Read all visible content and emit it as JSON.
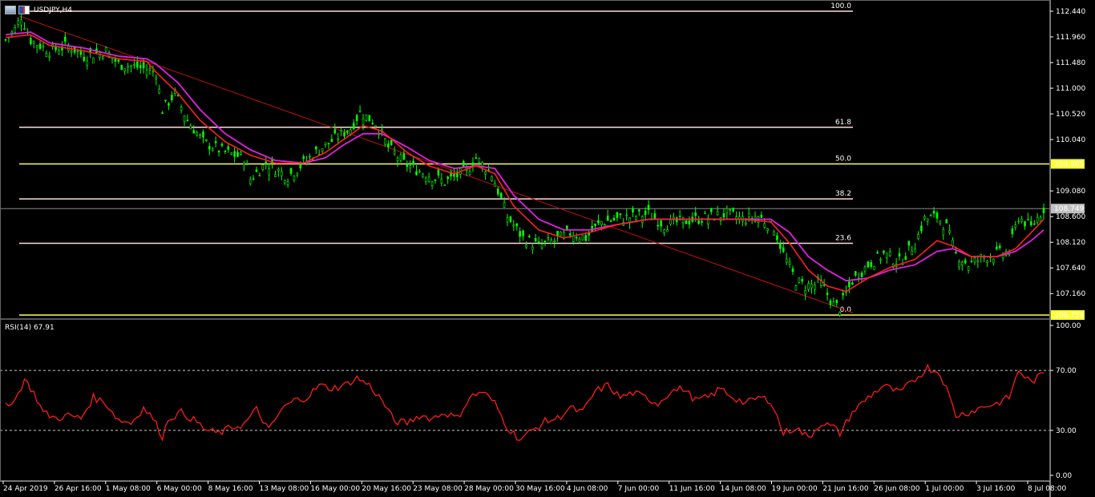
{
  "window": {
    "symbol_label": "USDJPY,H4",
    "rsi_label": "RSI(14) 67.91"
  },
  "colors": {
    "bg": "#000000",
    "candle": "#00ff00",
    "ma_fast": "#ff2020",
    "ma_slow": "#e020e0",
    "fib_line": "#ffdcdc",
    "fib_key": "#ffff66",
    "trend": "#c01010",
    "rsi": "#ff1a1a",
    "axis": "#ffffff"
  },
  "chart_data": [
    {
      "type": "candlestick",
      "title": "USDJPY,H4",
      "ylim": [
        106.759,
        112.44
      ],
      "y_ticks": [
        "112.440",
        "111.960",
        "111.480",
        "111.000",
        "110.520",
        "110.040",
        "109.080",
        "108.600",
        "108.120",
        "107.640",
        "107.160"
      ],
      "x_ticks": [
        "24 Apr 2019",
        "26 Apr 16:00",
        "1 May 08:00",
        "6 May 00:00",
        "8 May 16:00",
        "13 May 08:00",
        "16 May 00:00",
        "20 May 16:00",
        "23 May 08:00",
        "28 May 00:00",
        "30 May 16:00",
        "4 Jun 08:00",
        "7 Jun 00:00",
        "11 Jun 16:00",
        "14 Jun 08:00",
        "19 Jun 00:00",
        "21 Jun 16:00",
        "26 Jun 08:00",
        "1 Jul 00:00",
        "3 Jul 16:00",
        "8 Jul 08:00"
      ],
      "price_labels": {
        "current": "108.749",
        "fib_50": "109.585",
        "fib_0": "106.759"
      },
      "fibonacci": [
        {
          "level": "100.0",
          "price": 112.44
        },
        {
          "level": "61.8",
          "price": 110.27
        },
        {
          "level": "50.0",
          "price": 109.585
        },
        {
          "level": "38.2",
          "price": 108.93
        },
        {
          "level": "23.6",
          "price": 108.1
        },
        {
          "level": "0.0",
          "price": 106.759
        }
      ],
      "trendline": {
        "from": 112.35,
        "to": 106.8
      },
      "close_path": [
        [
          0,
          111.9
        ],
        [
          3,
          112.1
        ],
        [
          5,
          112.35
        ],
        [
          8,
          111.9
        ],
        [
          14,
          111.7
        ],
        [
          20,
          111.8
        ],
        [
          25,
          111.6
        ],
        [
          32,
          111.7
        ],
        [
          36,
          111.45
        ],
        [
          42,
          111.4
        ],
        [
          48,
          111.3
        ],
        [
          50,
          110.6
        ],
        [
          54,
          110.9
        ],
        [
          58,
          110.4
        ],
        [
          63,
          110.0
        ],
        [
          70,
          109.8
        ],
        [
          76,
          109.7
        ],
        [
          78,
          109.3
        ],
        [
          83,
          109.6
        ],
        [
          90,
          109.35
        ],
        [
          95,
          109.6
        ],
        [
          100,
          109.85
        ],
        [
          106,
          110.1
        ],
        [
          110,
          110.25
        ],
        [
          113,
          110.55
        ],
        [
          118,
          110.35
        ],
        [
          122,
          109.9
        ],
        [
          127,
          109.6
        ],
        [
          132,
          109.45
        ],
        [
          140,
          109.25
        ],
        [
          147,
          109.45
        ],
        [
          150,
          109.7
        ],
        [
          155,
          109.4
        ],
        [
          160,
          108.6
        ],
        [
          165,
          108.2
        ],
        [
          170,
          108.05
        ],
        [
          175,
          108.15
        ],
        [
          180,
          108.3
        ],
        [
          185,
          108.2
        ],
        [
          190,
          108.5
        ],
        [
          195,
          108.55
        ],
        [
          200,
          108.6
        ],
        [
          205,
          108.65
        ],
        [
          210,
          108.45
        ],
        [
          215,
          108.5
        ],
        [
          220,
          108.55
        ],
        [
          225,
          108.6
        ],
        [
          230,
          108.65
        ],
        [
          235,
          108.55
        ],
        [
          240,
          108.6
        ],
        [
          245,
          108.4
        ],
        [
          248,
          107.9
        ],
        [
          252,
          107.4
        ],
        [
          255,
          107.3
        ],
        [
          260,
          107.35
        ],
        [
          264,
          106.95
        ],
        [
          266,
          106.9
        ],
        [
          270,
          107.4
        ],
        [
          275,
          107.7
        ],
        [
          280,
          107.9
        ],
        [
          285,
          107.75
        ],
        [
          290,
          108.1
        ],
        [
          293,
          108.55
        ],
        [
          297,
          108.6
        ],
        [
          300,
          108.4
        ],
        [
          303,
          107.9
        ],
        [
          307,
          107.7
        ],
        [
          312,
          107.85
        ],
        [
          316,
          107.9
        ],
        [
          320,
          107.95
        ],
        [
          323,
          108.6
        ],
        [
          327,
          108.4
        ],
        [
          331,
          108.75
        ]
      ],
      "ma_fast_path": [
        [
          0,
          111.95
        ],
        [
          8,
          112.0
        ],
        [
          14,
          111.8
        ],
        [
          25,
          111.7
        ],
        [
          36,
          111.55
        ],
        [
          45,
          111.5
        ],
        [
          48,
          111.3
        ],
        [
          55,
          110.9
        ],
        [
          62,
          110.4
        ],
        [
          70,
          110.0
        ],
        [
          78,
          109.75
        ],
        [
          86,
          109.6
        ],
        [
          95,
          109.6
        ],
        [
          102,
          109.8
        ],
        [
          108,
          110.05
        ],
        [
          114,
          110.3
        ],
        [
          120,
          110.2
        ],
        [
          128,
          109.8
        ],
        [
          135,
          109.55
        ],
        [
          143,
          109.4
        ],
        [
          150,
          109.55
        ],
        [
          156,
          109.4
        ],
        [
          162,
          108.8
        ],
        [
          170,
          108.35
        ],
        [
          178,
          108.2
        ],
        [
          186,
          108.3
        ],
        [
          195,
          108.45
        ],
        [
          205,
          108.55
        ],
        [
          215,
          108.55
        ],
        [
          225,
          108.55
        ],
        [
          235,
          108.55
        ],
        [
          244,
          108.5
        ],
        [
          250,
          108.1
        ],
        [
          256,
          107.6
        ],
        [
          262,
          107.3
        ],
        [
          268,
          107.2
        ],
        [
          275,
          107.45
        ],
        [
          282,
          107.65
        ],
        [
          290,
          107.8
        ],
        [
          297,
          108.15
        ],
        [
          302,
          108.05
        ],
        [
          308,
          107.85
        ],
        [
          316,
          107.85
        ],
        [
          322,
          108.0
        ],
        [
          327,
          108.3
        ],
        [
          331,
          108.55
        ]
      ],
      "ma_slow_path": [
        [
          0,
          112.0
        ],
        [
          8,
          112.05
        ],
        [
          14,
          111.85
        ],
        [
          25,
          111.75
        ],
        [
          36,
          111.6
        ],
        [
          45,
          111.55
        ],
        [
          48,
          111.45
        ],
        [
          55,
          111.1
        ],
        [
          62,
          110.6
        ],
        [
          70,
          110.15
        ],
        [
          78,
          109.85
        ],
        [
          86,
          109.65
        ],
        [
          95,
          109.6
        ],
        [
          102,
          109.7
        ],
        [
          108,
          109.95
        ],
        [
          114,
          110.15
        ],
        [
          120,
          110.15
        ],
        [
          128,
          109.9
        ],
        [
          135,
          109.65
        ],
        [
          143,
          109.5
        ],
        [
          150,
          109.55
        ],
        [
          156,
          109.5
        ],
        [
          162,
          109.0
        ],
        [
          170,
          108.55
        ],
        [
          178,
          108.35
        ],
        [
          186,
          108.35
        ],
        [
          195,
          108.45
        ],
        [
          205,
          108.55
        ],
        [
          215,
          108.55
        ],
        [
          225,
          108.55
        ],
        [
          235,
          108.55
        ],
        [
          244,
          108.55
        ],
        [
          250,
          108.3
        ],
        [
          256,
          107.85
        ],
        [
          262,
          107.6
        ],
        [
          268,
          107.4
        ],
        [
          275,
          107.45
        ],
        [
          282,
          107.6
        ],
        [
          290,
          107.7
        ],
        [
          297,
          107.95
        ],
        [
          302,
          108.0
        ],
        [
          308,
          107.85
        ],
        [
          316,
          107.85
        ],
        [
          322,
          107.95
        ],
        [
          327,
          108.15
        ],
        [
          331,
          108.35
        ]
      ]
    },
    {
      "type": "line",
      "title": "RSI(14) 67.91",
      "ylim": [
        0,
        100
      ],
      "y_ticks": [
        "100.00",
        "70.00",
        "30.00",
        "0.00"
      ],
      "levels": [
        70,
        30
      ],
      "rsi_path": [
        [
          0,
          48
        ],
        [
          3,
          50
        ],
        [
          6,
          64
        ],
        [
          9,
          55
        ],
        [
          12,
          42
        ],
        [
          16,
          38
        ],
        [
          20,
          40
        ],
        [
          24,
          38
        ],
        [
          28,
          52
        ],
        [
          32,
          48
        ],
        [
          36,
          37
        ],
        [
          40,
          35
        ],
        [
          44,
          45
        ],
        [
          47,
          38
        ],
        [
          50,
          26
        ],
        [
          52,
          38
        ],
        [
          56,
          42
        ],
        [
          60,
          37
        ],
        [
          64,
          30
        ],
        [
          68,
          28
        ],
        [
          72,
          32
        ],
        [
          76,
          34
        ],
        [
          80,
          44
        ],
        [
          84,
          30
        ],
        [
          88,
          44
        ],
        [
          92,
          50
        ],
        [
          96,
          52
        ],
        [
          100,
          60
        ],
        [
          104,
          58
        ],
        [
          108,
          60
        ],
        [
          112,
          65
        ],
        [
          116,
          60
        ],
        [
          120,
          50
        ],
        [
          124,
          36
        ],
        [
          128,
          35
        ],
        [
          132,
          40
        ],
        [
          136,
          38
        ],
        [
          140,
          42
        ],
        [
          144,
          38
        ],
        [
          148,
          52
        ],
        [
          152,
          56
        ],
        [
          156,
          48
        ],
        [
          160,
          32
        ],
        [
          164,
          24
        ],
        [
          168,
          30
        ],
        [
          172,
          36
        ],
        [
          176,
          38
        ],
        [
          180,
          45
        ],
        [
          184,
          42
        ],
        [
          188,
          56
        ],
        [
          192,
          60
        ],
        [
          196,
          52
        ],
        [
          200,
          55
        ],
        [
          204,
          52
        ],
        [
          208,
          48
        ],
        [
          212,
          56
        ],
        [
          216,
          58
        ],
        [
          220,
          50
        ],
        [
          224,
          52
        ],
        [
          228,
          58
        ],
        [
          232,
          52
        ],
        [
          236,
          48
        ],
        [
          240,
          52
        ],
        [
          244,
          50
        ],
        [
          248,
          28
        ],
        [
          252,
          32
        ],
        [
          256,
          25
        ],
        [
          260,
          35
        ],
        [
          264,
          32
        ],
        [
          266,
          28
        ],
        [
          270,
          42
        ],
        [
          275,
          52
        ],
        [
          280,
          60
        ],
        [
          285,
          55
        ],
        [
          290,
          64
        ],
        [
          294,
          72
        ],
        [
          298,
          68
        ],
        [
          300,
          58
        ],
        [
          303,
          40
        ],
        [
          307,
          42
        ],
        [
          312,
          46
        ],
        [
          316,
          48
        ],
        [
          320,
          52
        ],
        [
          323,
          70
        ],
        [
          327,
          62
        ],
        [
          331,
          68
        ]
      ]
    }
  ]
}
